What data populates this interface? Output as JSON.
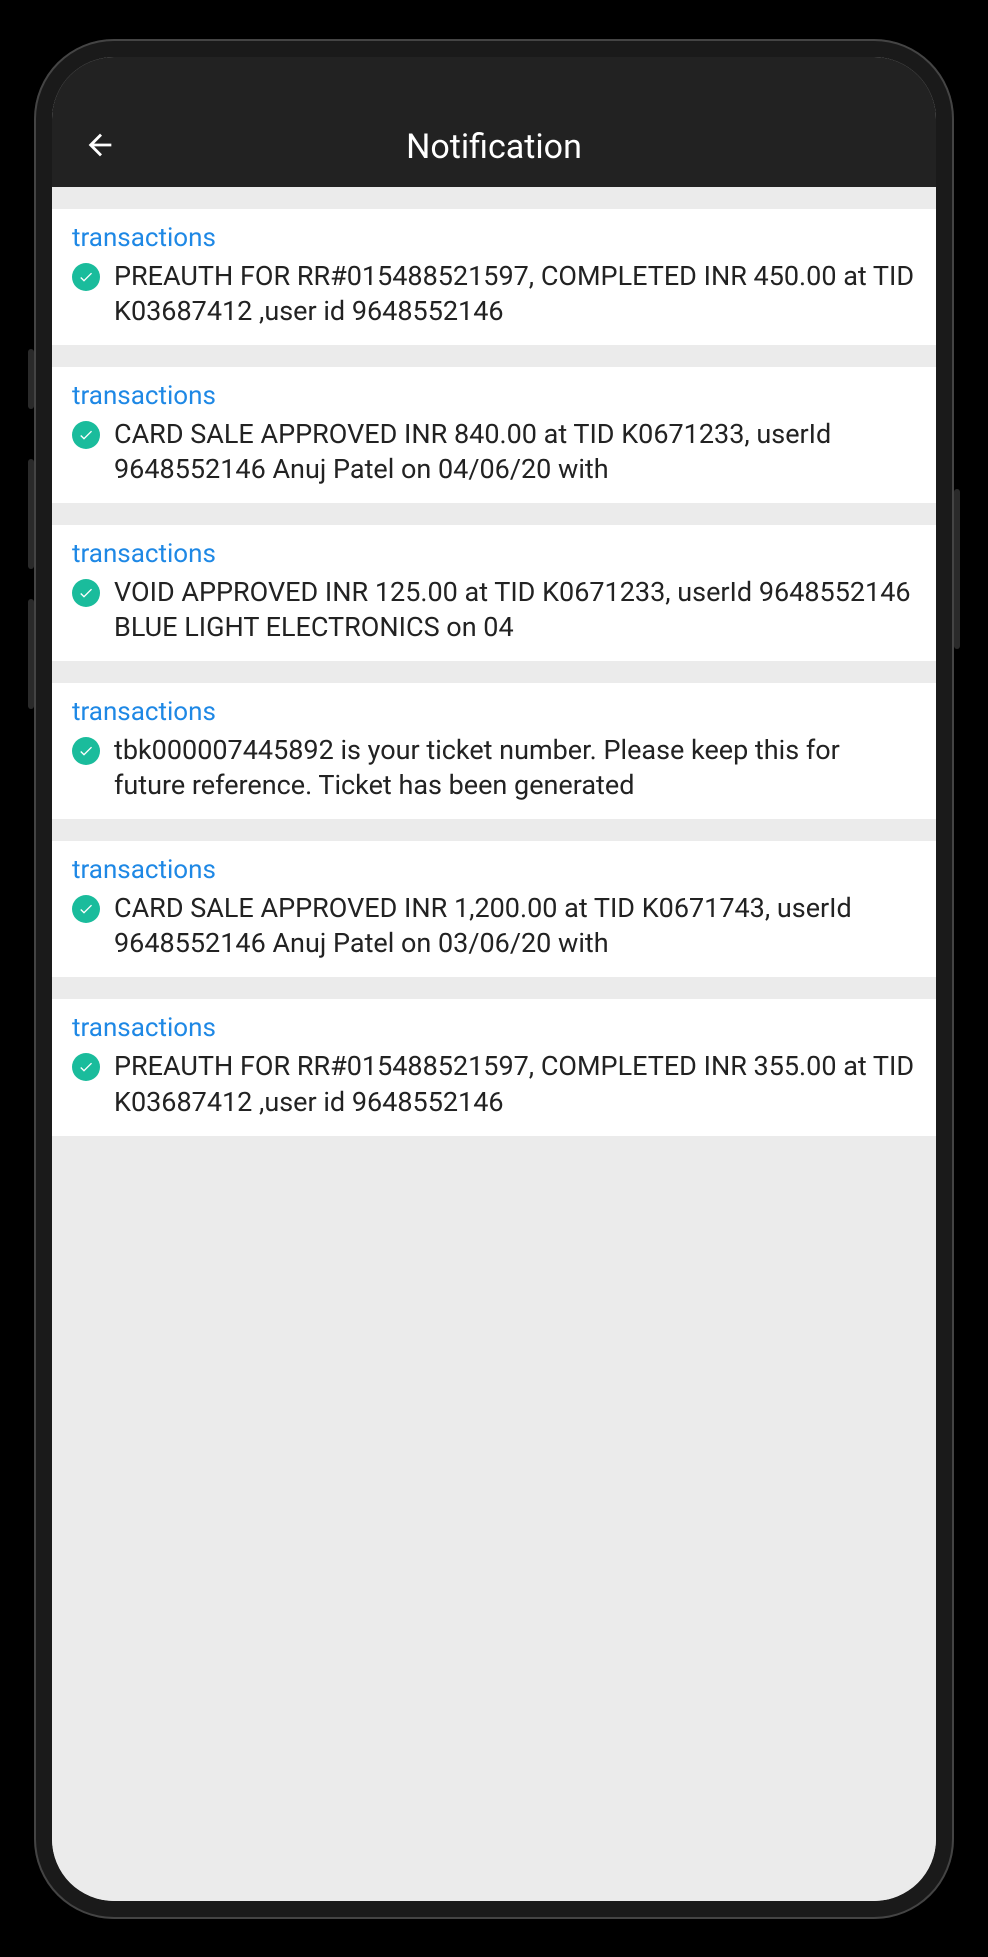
{
  "header": {
    "title": "Notification"
  },
  "notifications": [
    {
      "category": "transactions",
      "text": "PREAUTH FOR RR#015488521597, COMPLETED INR 450.00 at TID K03687412 ,user id 9648552146"
    },
    {
      "category": "transactions",
      "text": "CARD SALE APPROVED INR 840.00 at TID K0671233, userId 9648552146 Anuj Patel on 04/06/20 with"
    },
    {
      "category": "transactions",
      "text": "VOID APPROVED INR 125.00 at TID K0671233, userId 9648552146 BLUE LIGHT ELECTRONICS on 04"
    },
    {
      "category": "transactions",
      "text": "tbk000007445892 is your ticket number. Please keep this for future reference. Ticket has been generated"
    },
    {
      "category": "transactions",
      "text": "CARD SALE APPROVED INR 1,200.00 at TID K0671743, userId 9648552146 Anuj Patel on 03/06/20 with"
    },
    {
      "category": "transactions",
      "text": "PREAUTH FOR RR#015488521597, COMPLETED INR 355.00 at TID K03687412 ,user id 9648552146"
    }
  ]
}
